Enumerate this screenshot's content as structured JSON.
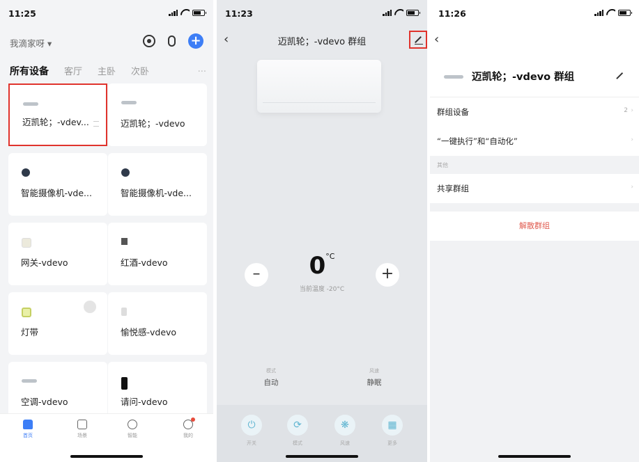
{
  "panel1": {
    "time": "11:25",
    "home_name": "我滴家呀 ▾",
    "tabs": [
      "所有设备",
      "客厅",
      "主卧",
      "次卧"
    ],
    "tabs_more": "··· ",
    "devices": [
      {
        "name": "迈凯轮；-vdev...",
        "icon": "ac-icon"
      },
      {
        "name": "迈凯轮；-vdevo",
        "icon": "ac-icon"
      },
      {
        "name": "智能摄像机-vde...",
        "icon": "camera-icon"
      },
      {
        "name": "智能摄像机-vde...",
        "icon": "camera-icon"
      },
      {
        "name": "网关-vdevo",
        "icon": "gateway-icon"
      },
      {
        "name": "红酒-vdevo",
        "icon": "wine-icon"
      },
      {
        "name": "灯带",
        "icon": "light-strip-icon"
      },
      {
        "name": "愉悦感-vdevo",
        "icon": "sensor-icon"
      },
      {
        "name": "空调-vdevo",
        "icon": "ac-icon"
      },
      {
        "name": "请问-vdevo",
        "icon": "phone-icon"
      }
    ],
    "tabbar": [
      "首页",
      "场景",
      "智能",
      "我的"
    ]
  },
  "panel2": {
    "time": "11:23",
    "title": "迈凯轮；-vdevo 群组",
    "temp": "0",
    "temp_unit": "°C",
    "temp_sub": "当前温度 -20°C",
    "mode_label": "模式",
    "mode_value": "自动",
    "wind_label": "风速",
    "wind_value": "静眠",
    "controls": [
      "开关",
      "模式",
      "风速",
      "更多"
    ]
  },
  "panel3": {
    "time": "11:26",
    "group_title": "迈凯轮；-vdevo 群组",
    "rows": {
      "group_devices": "群组设备",
      "group_devices_count": "2",
      "automation": "“一键执行”和“自动化”",
      "other_section": "其他",
      "share": "共享群组",
      "dissolve": "解散群组"
    }
  },
  "colors": {
    "accent": "#3d7ef6",
    "highlight": "#e0332c",
    "danger": "#e05b4f",
    "control": "#5fb5d1"
  }
}
